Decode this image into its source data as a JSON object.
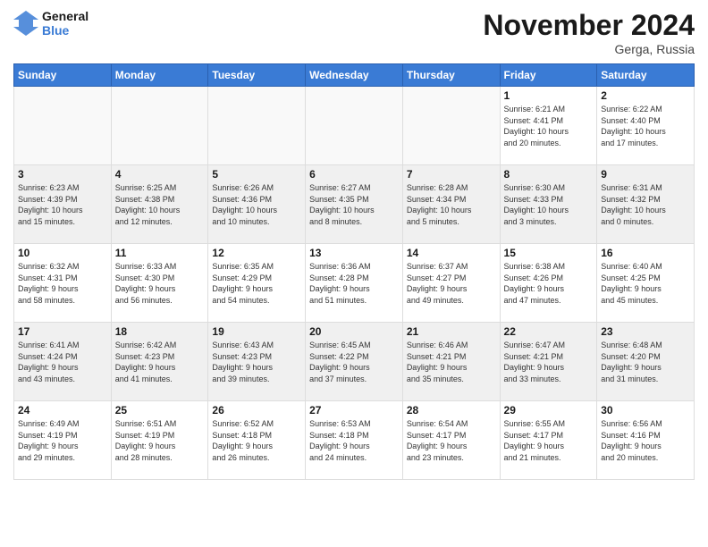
{
  "header": {
    "logo_line1": "General",
    "logo_line2": "Blue",
    "month_title": "November 2024",
    "location": "Gerga, Russia"
  },
  "weekdays": [
    "Sunday",
    "Monday",
    "Tuesday",
    "Wednesday",
    "Thursday",
    "Friday",
    "Saturday"
  ],
  "weeks": [
    [
      {
        "day": "",
        "info": ""
      },
      {
        "day": "",
        "info": ""
      },
      {
        "day": "",
        "info": ""
      },
      {
        "day": "",
        "info": ""
      },
      {
        "day": "",
        "info": ""
      },
      {
        "day": "1",
        "info": "Sunrise: 6:21 AM\nSunset: 4:41 PM\nDaylight: 10 hours\nand 20 minutes."
      },
      {
        "day": "2",
        "info": "Sunrise: 6:22 AM\nSunset: 4:40 PM\nDaylight: 10 hours\nand 17 minutes."
      }
    ],
    [
      {
        "day": "3",
        "info": "Sunrise: 6:23 AM\nSunset: 4:39 PM\nDaylight: 10 hours\nand 15 minutes."
      },
      {
        "day": "4",
        "info": "Sunrise: 6:25 AM\nSunset: 4:38 PM\nDaylight: 10 hours\nand 12 minutes."
      },
      {
        "day": "5",
        "info": "Sunrise: 6:26 AM\nSunset: 4:36 PM\nDaylight: 10 hours\nand 10 minutes."
      },
      {
        "day": "6",
        "info": "Sunrise: 6:27 AM\nSunset: 4:35 PM\nDaylight: 10 hours\nand 8 minutes."
      },
      {
        "day": "7",
        "info": "Sunrise: 6:28 AM\nSunset: 4:34 PM\nDaylight: 10 hours\nand 5 minutes."
      },
      {
        "day": "8",
        "info": "Sunrise: 6:30 AM\nSunset: 4:33 PM\nDaylight: 10 hours\nand 3 minutes."
      },
      {
        "day": "9",
        "info": "Sunrise: 6:31 AM\nSunset: 4:32 PM\nDaylight: 10 hours\nand 0 minutes."
      }
    ],
    [
      {
        "day": "10",
        "info": "Sunrise: 6:32 AM\nSunset: 4:31 PM\nDaylight: 9 hours\nand 58 minutes."
      },
      {
        "day": "11",
        "info": "Sunrise: 6:33 AM\nSunset: 4:30 PM\nDaylight: 9 hours\nand 56 minutes."
      },
      {
        "day": "12",
        "info": "Sunrise: 6:35 AM\nSunset: 4:29 PM\nDaylight: 9 hours\nand 54 minutes."
      },
      {
        "day": "13",
        "info": "Sunrise: 6:36 AM\nSunset: 4:28 PM\nDaylight: 9 hours\nand 51 minutes."
      },
      {
        "day": "14",
        "info": "Sunrise: 6:37 AM\nSunset: 4:27 PM\nDaylight: 9 hours\nand 49 minutes."
      },
      {
        "day": "15",
        "info": "Sunrise: 6:38 AM\nSunset: 4:26 PM\nDaylight: 9 hours\nand 47 minutes."
      },
      {
        "day": "16",
        "info": "Sunrise: 6:40 AM\nSunset: 4:25 PM\nDaylight: 9 hours\nand 45 minutes."
      }
    ],
    [
      {
        "day": "17",
        "info": "Sunrise: 6:41 AM\nSunset: 4:24 PM\nDaylight: 9 hours\nand 43 minutes."
      },
      {
        "day": "18",
        "info": "Sunrise: 6:42 AM\nSunset: 4:23 PM\nDaylight: 9 hours\nand 41 minutes."
      },
      {
        "day": "19",
        "info": "Sunrise: 6:43 AM\nSunset: 4:23 PM\nDaylight: 9 hours\nand 39 minutes."
      },
      {
        "day": "20",
        "info": "Sunrise: 6:45 AM\nSunset: 4:22 PM\nDaylight: 9 hours\nand 37 minutes."
      },
      {
        "day": "21",
        "info": "Sunrise: 6:46 AM\nSunset: 4:21 PM\nDaylight: 9 hours\nand 35 minutes."
      },
      {
        "day": "22",
        "info": "Sunrise: 6:47 AM\nSunset: 4:21 PM\nDaylight: 9 hours\nand 33 minutes."
      },
      {
        "day": "23",
        "info": "Sunrise: 6:48 AM\nSunset: 4:20 PM\nDaylight: 9 hours\nand 31 minutes."
      }
    ],
    [
      {
        "day": "24",
        "info": "Sunrise: 6:49 AM\nSunset: 4:19 PM\nDaylight: 9 hours\nand 29 minutes."
      },
      {
        "day": "25",
        "info": "Sunrise: 6:51 AM\nSunset: 4:19 PM\nDaylight: 9 hours\nand 28 minutes."
      },
      {
        "day": "26",
        "info": "Sunrise: 6:52 AM\nSunset: 4:18 PM\nDaylight: 9 hours\nand 26 minutes."
      },
      {
        "day": "27",
        "info": "Sunrise: 6:53 AM\nSunset: 4:18 PM\nDaylight: 9 hours\nand 24 minutes."
      },
      {
        "day": "28",
        "info": "Sunrise: 6:54 AM\nSunset: 4:17 PM\nDaylight: 9 hours\nand 23 minutes."
      },
      {
        "day": "29",
        "info": "Sunrise: 6:55 AM\nSunset: 4:17 PM\nDaylight: 9 hours\nand 21 minutes."
      },
      {
        "day": "30",
        "info": "Sunrise: 6:56 AM\nSunset: 4:16 PM\nDaylight: 9 hours\nand 20 minutes."
      }
    ]
  ]
}
